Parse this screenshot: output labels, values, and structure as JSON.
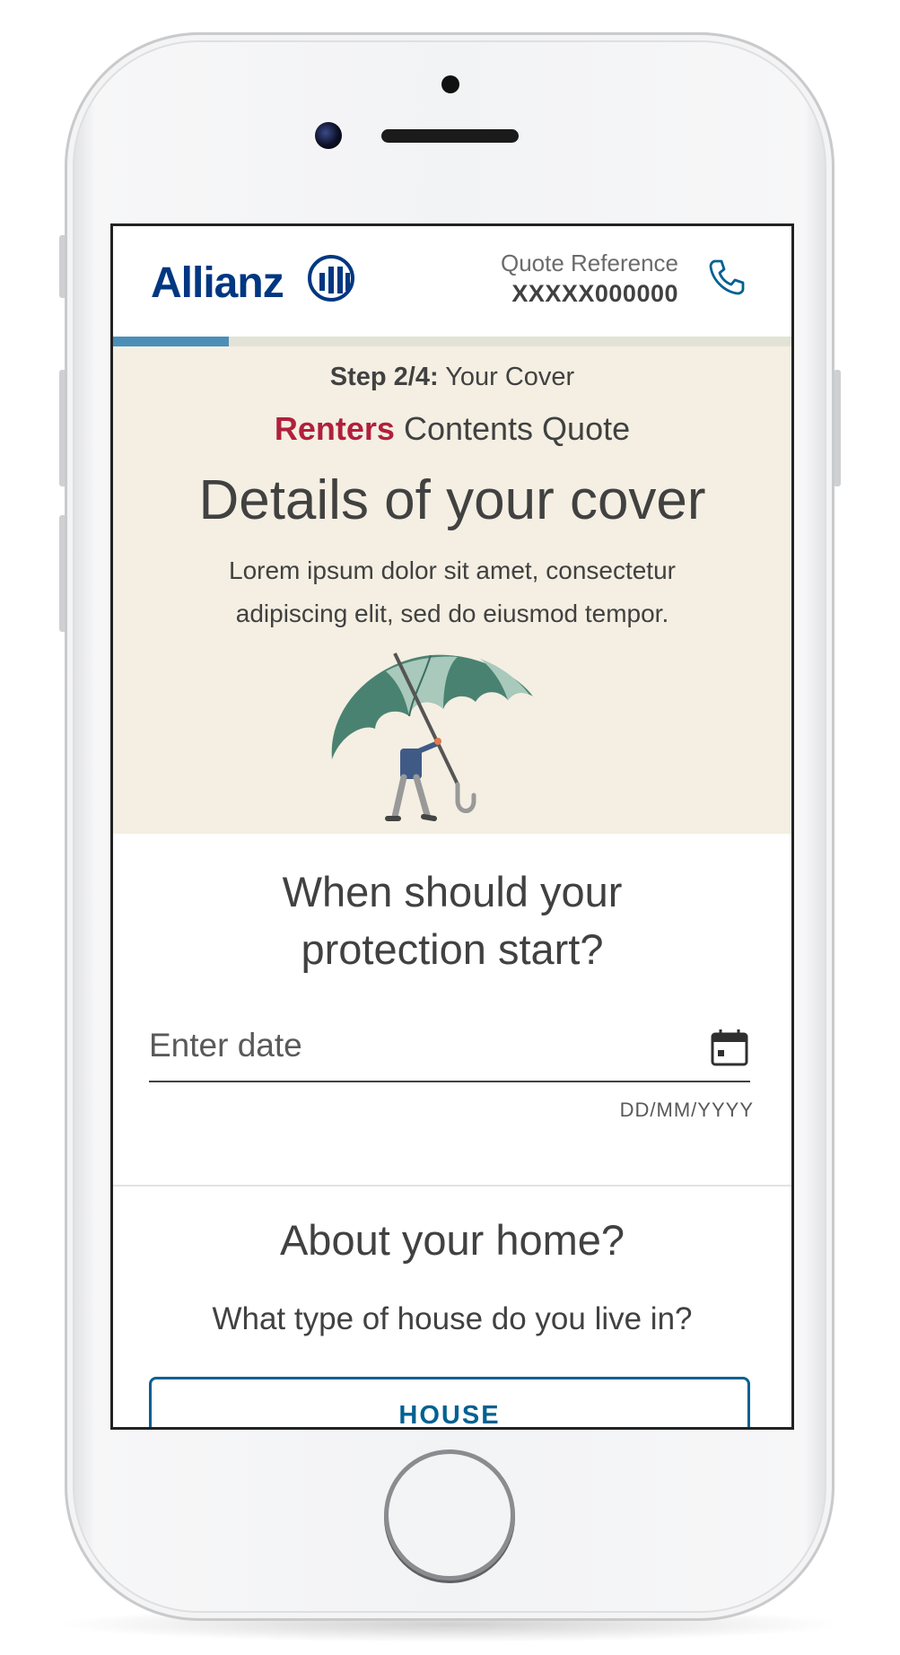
{
  "header": {
    "brand": "Allianz",
    "quote_label": "Quote Reference",
    "quote_ref": "XXXXX000000"
  },
  "progress": {
    "fraction": 0.17
  },
  "hero": {
    "step_strong": "Step 2/4:",
    "step_text": "Your Cover",
    "product_accent": "Renters",
    "product_rest": "Contents Quote",
    "title": "Details of your cover",
    "description": "Lorem ipsum dolor sit amet, consectetur adipiscing elit, sed do eiusmod tempor."
  },
  "start_section": {
    "question_line1": "When should your",
    "question_line2": "protection start?",
    "date_placeholder": "Enter date",
    "date_format_hint": "DD/MM/YYYY"
  },
  "home_section": {
    "title": "About your home?",
    "question": "What type of house do you live in?",
    "option_house": "HOUSE"
  },
  "icons": {
    "phone": "phone-icon",
    "calendar": "calendar-icon",
    "logo": "allianz-logo-icon"
  },
  "colors": {
    "brand_blue": "#003781",
    "accent_red": "#b0203c",
    "hero_bg": "#f4efe2",
    "progress_fill": "#4b8fb8",
    "button_blue": "#006192"
  }
}
